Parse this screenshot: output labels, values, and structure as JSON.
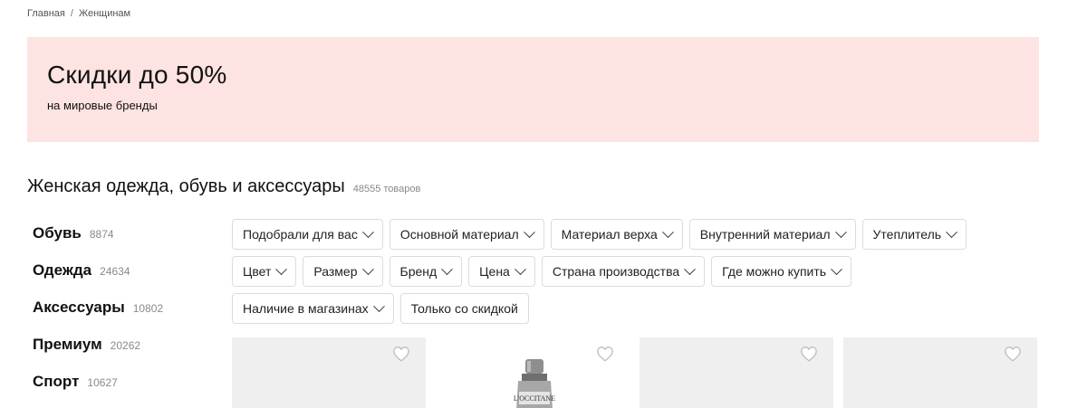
{
  "breadcrumb": {
    "items": [
      "Главная",
      "Женщинам"
    ],
    "separator": "/"
  },
  "banner": {
    "title": "Скидки до 50%",
    "subtitle": "на мировые бренды",
    "bg_color": "#fde3e1"
  },
  "catalog": {
    "title": "Женская одежда, обувь и аксессуары",
    "count": "48555 товаров"
  },
  "categories": [
    {
      "name": "Обувь",
      "count": "8874"
    },
    {
      "name": "Одежда",
      "count": "24634"
    },
    {
      "name": "Аксессуары",
      "count": "10802"
    },
    {
      "name": "Премиум",
      "count": "20262"
    },
    {
      "name": "Спорт",
      "count": "10627"
    }
  ],
  "filters": {
    "row1": [
      "Подобрали для вас",
      "Основной материал",
      "Материал верха",
      "Внутренний материал",
      "Утеплитель"
    ],
    "row2": [
      "Цвет",
      "Размер",
      "Бренд",
      "Цена",
      "Страна производства",
      "Где можно купить"
    ],
    "row3": [
      "Наличие в магазинах"
    ],
    "toggle": "Только со скидкой"
  },
  "products": [
    {
      "icon": "heart-icon",
      "bg": "gray"
    },
    {
      "icon": "heart-icon",
      "bg": "white",
      "brand": "L'OCCITANE"
    },
    {
      "icon": "heart-icon",
      "bg": "gray"
    },
    {
      "icon": "heart-icon",
      "bg": "gray"
    }
  ]
}
